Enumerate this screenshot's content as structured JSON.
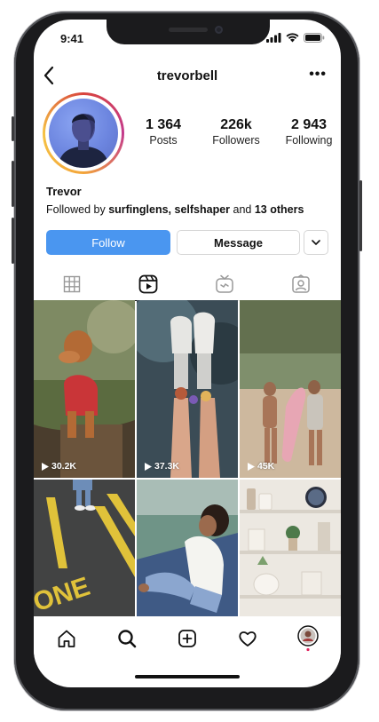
{
  "status": {
    "time": "9:41"
  },
  "header": {
    "username": "trevorbell",
    "more": "•••"
  },
  "profile": {
    "stats": [
      {
        "value": "1 364",
        "label": "Posts"
      },
      {
        "value": "226k",
        "label": "Followers"
      },
      {
        "value": "2 943",
        "label": "Following"
      }
    ],
    "name": "Trevor",
    "followed_by": {
      "prefix": "Followed by ",
      "names": "surfinglens, selfshaper",
      "mid": " and ",
      "others": "13 others"
    }
  },
  "actions": {
    "follow": "Follow",
    "message": "Message"
  },
  "tabs": [
    "grid-icon",
    "reels-icon",
    "igtv-icon",
    "tagged-icon"
  ],
  "grid": {
    "items": [
      {
        "views": "30.2K"
      },
      {
        "views": "37.3K"
      },
      {
        "views": "45K"
      },
      {
        "views": ""
      },
      {
        "views": ""
      },
      {
        "views": ""
      }
    ],
    "street_text": "ONE"
  },
  "colors": {
    "accent": "#4a96f0",
    "text": "#111111",
    "border": "#d6d6d6"
  },
  "bottom_nav": [
    "home-icon",
    "search-icon",
    "add-icon",
    "heart-icon",
    "profile-avatar"
  ]
}
